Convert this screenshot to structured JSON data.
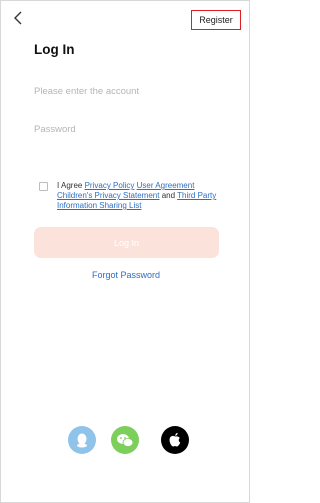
{
  "header": {
    "back_icon": "chevron-left-icon",
    "register_label": "Register"
  },
  "title": "Log In",
  "form": {
    "account_placeholder": "Please enter the account",
    "password_placeholder": "Password",
    "agreement": {
      "prefix": "I Agree",
      "privacy_policy": "Privacy Policy",
      "user_agreement": "User Agreement",
      "childrens_privacy": "Children's Privacy Statement",
      "and": "and",
      "third_party": "Third Party Information Sharing List"
    },
    "login_label": "Log In",
    "forgot_label": "Forgot Password"
  },
  "social": {
    "icons": [
      "qq-icon",
      "wechat-icon",
      "apple-icon"
    ]
  },
  "colors": {
    "accent_red": "#e02020",
    "link_blue": "#2b6fc4",
    "login_disabled": "#fbe2da",
    "qq": "#8fc3e9",
    "wechat": "#7bcf5a",
    "apple": "#000000"
  }
}
